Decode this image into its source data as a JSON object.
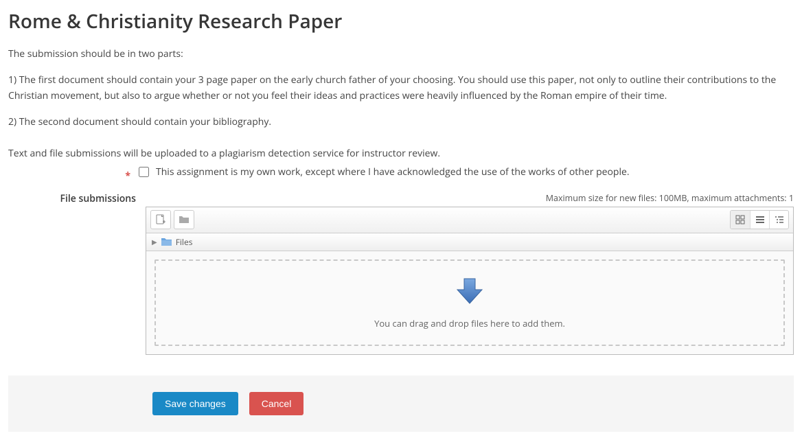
{
  "title": "Rome & Christianity Research Paper",
  "intro": "The submission should be in two parts:",
  "part1": "1) The first document should contain your 3 page paper on the early church father of your choosing. You should use this paper, not only to outline their contributions to the Christian movement, but also to argue whether or not you feel their ideas and practices were heavily influenced by the Roman empire of their time.",
  "part2": "2) The second document should contain your bibliography.",
  "plagiarism_notice": "Text and file submissions will be uploaded to a plagiarism detection service for instructor review.",
  "required_marker": "*",
  "acknowledgement": "This assignment is my own work, except where I have acknowledged the use of the works of other people.",
  "file_section_label": "File submissions",
  "max_info": "Maximum size for new files: 100MB, maximum attachments: 1",
  "path_label": "Files",
  "drop_msg": "You can drag and drop files here to add them.",
  "buttons": {
    "save": "Save changes",
    "cancel": "Cancel"
  }
}
